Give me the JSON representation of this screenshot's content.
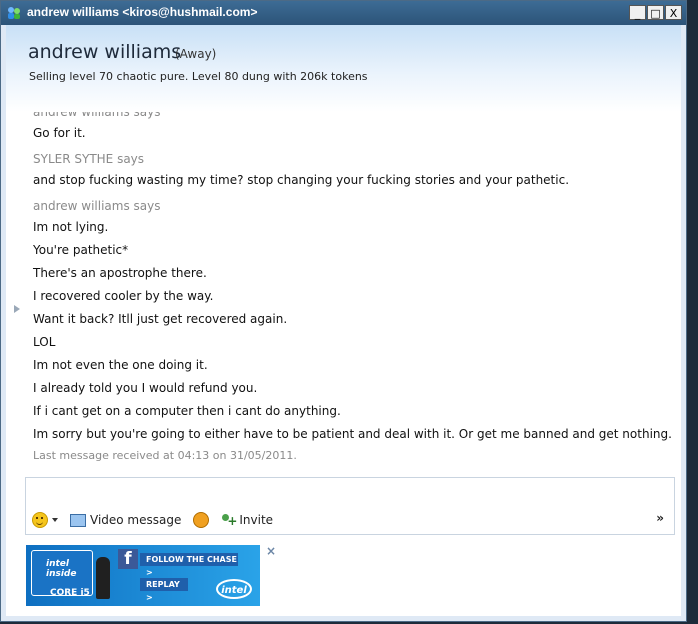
{
  "window": {
    "title": "andrew williams <kiros@hushmail.com>",
    "controls": {
      "minimize": "_",
      "maximize": "□",
      "close": "X"
    }
  },
  "header": {
    "contact_name": "andrew williams",
    "status": "(Away)",
    "personal_message": "Selling level 70 chaotic pure. Level 80 dung with 206k tokens"
  },
  "conversation": {
    "block1": {
      "sender": "andrew williams says",
      "lines": [
        "Go for it."
      ]
    },
    "block2": {
      "sender": "SYLER SYTHE says",
      "lines": [
        "and stop fucking wasting my time? stop changing your fucking stories and your pathetic."
      ]
    },
    "block3": {
      "sender": "andrew williams says",
      "lines": [
        "Im not lying.",
        "You're pathetic*",
        "There's an apostrophe there.",
        "I recovered cooler by the way.",
        "Want it back? Itll just get recovered again.",
        "LOL",
        "Im not even the one doing it.",
        "I already told you I would refund you.",
        "If i cant get on a computer then i cant do anything.",
        "Im sorry but you're going to either have to be patient and deal with it. Or get me banned and get nothing."
      ]
    },
    "last_message": "Last message received at 04:13 on 31/05/2011."
  },
  "toolbar": {
    "emoticon_icon": "smiley-icon",
    "video_message_label": "Video message",
    "invite_label": "Invite",
    "more_label": "»"
  },
  "ad": {
    "intel_inside": "intel inside",
    "core": "CORE i5",
    "follow": "FOLLOW THE CHASE  >",
    "replay": "REPLAY  >",
    "logo": "intel",
    "close": "×"
  }
}
